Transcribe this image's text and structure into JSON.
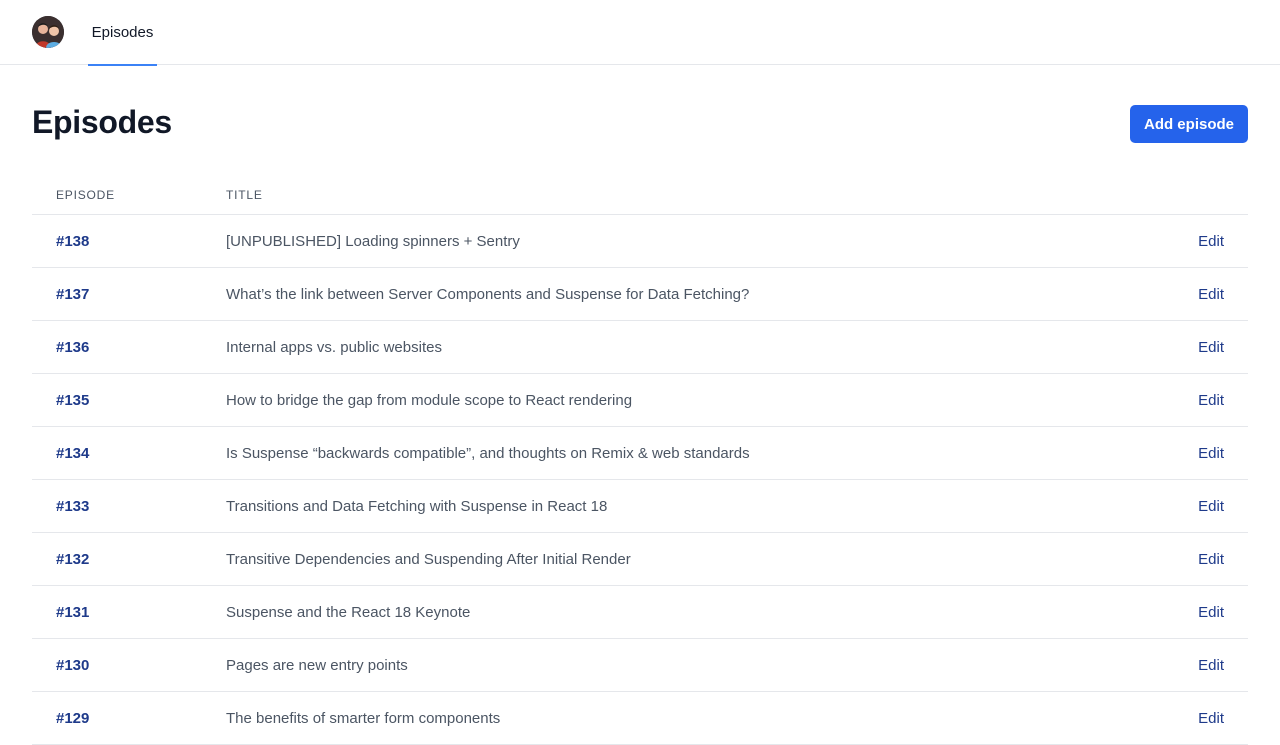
{
  "nav": {
    "tab_label": "Episodes"
  },
  "header": {
    "title": "Episodes",
    "add_button_label": "Add episode"
  },
  "colors": {
    "accent": "#2563eb",
    "link": "#1e3a8a",
    "tab_underline": "#3b82f6"
  },
  "table": {
    "columns": [
      "EPISODE",
      "TITLE"
    ],
    "edit_label": "Edit",
    "rows": [
      {
        "number": "#138",
        "title": "[UNPUBLISHED] Loading spinners + Sentry"
      },
      {
        "number": "#137",
        "title": "What’s the link between Server Components and Suspense for Data Fetching?"
      },
      {
        "number": "#136",
        "title": "Internal apps vs. public websites"
      },
      {
        "number": "#135",
        "title": "How to bridge the gap from module scope to React rendering"
      },
      {
        "number": "#134",
        "title": "Is Suspense “backwards compatible”, and thoughts on Remix & web standards"
      },
      {
        "number": "#133",
        "title": "Transitions and Data Fetching with Suspense in React 18"
      },
      {
        "number": "#132",
        "title": "Transitive Dependencies and Suspending After Initial Render"
      },
      {
        "number": "#131",
        "title": "Suspense and the React 18 Keynote"
      },
      {
        "number": "#130",
        "title": "Pages are new entry points"
      },
      {
        "number": "#129",
        "title": "The benefits of smarter form components"
      }
    ]
  }
}
